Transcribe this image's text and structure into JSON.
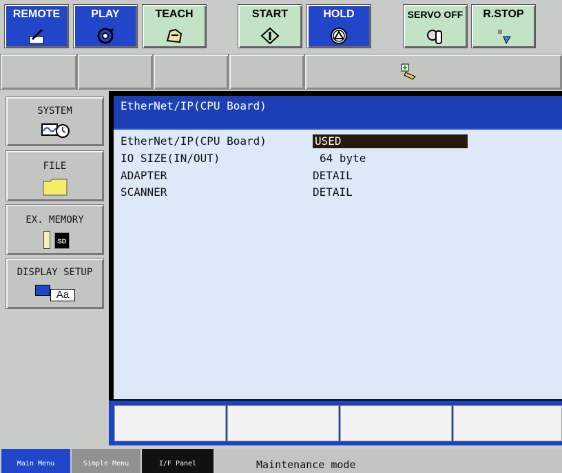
{
  "toolbar": {
    "remote": "REMOTE",
    "play": "PLAY",
    "teach": "TEACH",
    "start": "START",
    "hold": "HOLD",
    "servo_off": "SERVO OFF",
    "r_stop": "R.STOP"
  },
  "menu": {
    "system": "SYSTEM",
    "file": "FILE",
    "ex_memory": "EX. MEMORY",
    "display_setup": "DISPLAY SETUP",
    "sd_badge": "SD",
    "aa_badge": "Aa"
  },
  "screen": {
    "title": "EtherNet/IP(CPU Board)",
    "rows": [
      {
        "label": "EtherNet/IP(CPU Board)",
        "value": "USED"
      },
      {
        "label": "IO SIZE(IN/OUT)",
        "value": "64 byte"
      },
      {
        "label": "ADAPTER",
        "value": "DETAIL"
      },
      {
        "label": "SCANNER",
        "value": "DETAIL"
      }
    ]
  },
  "status": {
    "main_menu": "Main Menu",
    "simple_menu": "Simple Menu",
    "if_panel": "I/F Panel",
    "message": "Maintenance mode"
  },
  "colors": {
    "accent_blue": "#2146c9",
    "green_button": "#c3e3c6",
    "content_bg": "#dde9f8",
    "selected_bg": "#25190a"
  }
}
